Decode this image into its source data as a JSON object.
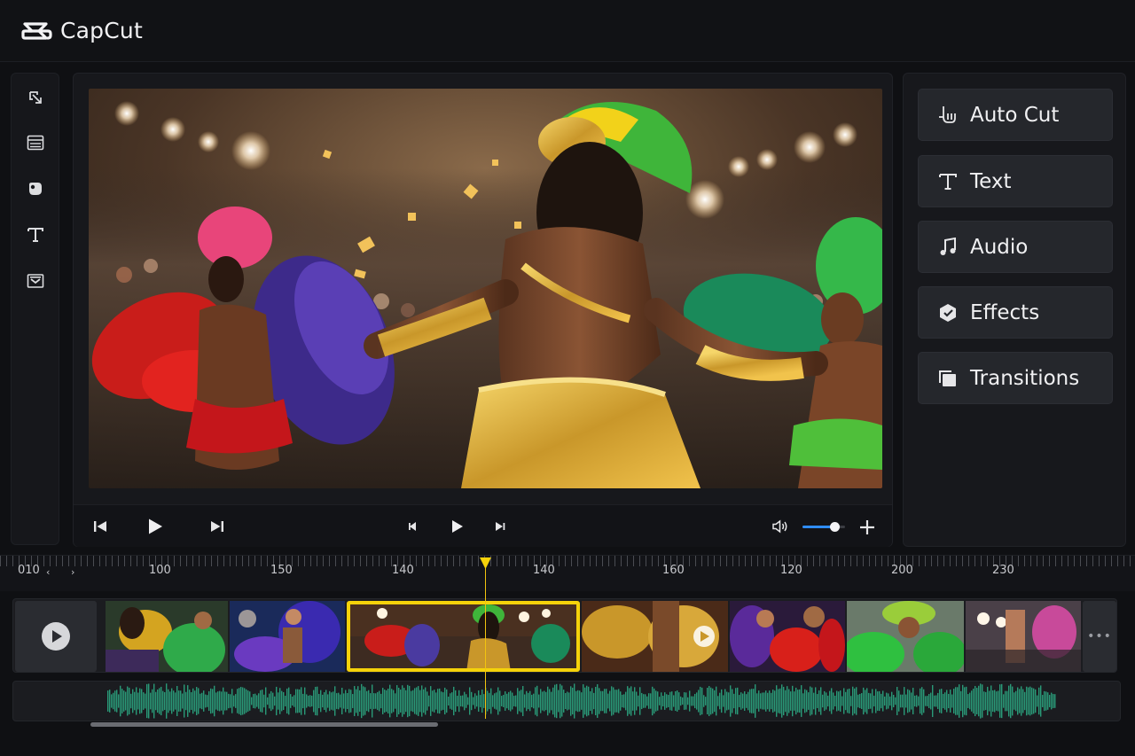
{
  "app": {
    "name": "CapCut",
    "accent": "#f5d20a",
    "slider_color": "#2f8cf5"
  },
  "left_toolbar": {
    "items": [
      {
        "icon": "import-icon"
      },
      {
        "icon": "media-icon"
      },
      {
        "icon": "sticker-icon"
      },
      {
        "icon": "text-icon"
      },
      {
        "icon": "template-icon"
      }
    ]
  },
  "player": {
    "volume": 0.75
  },
  "features": [
    {
      "label": "Auto Cut",
      "icon": "auto-cut-icon"
    },
    {
      "label": "Text",
      "icon": "text-icon"
    },
    {
      "label": "Audio",
      "icon": "music-note-icon"
    },
    {
      "label": "Effects",
      "icon": "effects-icon"
    },
    {
      "label": "Transitions",
      "icon": "transitions-icon"
    }
  ],
  "timeline": {
    "ruler_labels": [
      "010",
      "100",
      "150",
      "140",
      "140",
      "160",
      "120",
      "200",
      "230"
    ],
    "nav_prev": "‹",
    "nav_next": "›",
    "more_label": "•••"
  }
}
